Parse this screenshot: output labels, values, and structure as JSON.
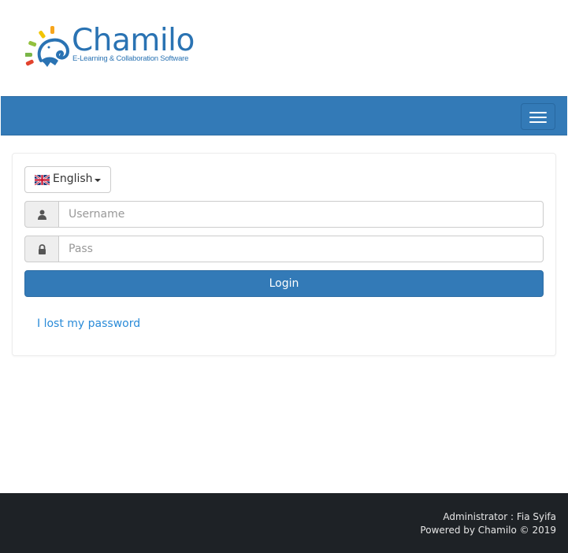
{
  "header": {
    "logo_name": "Chamilo",
    "logo_tagline": "E-Learning & Collaboration Software"
  },
  "navbar": {
    "color": "#337ab7",
    "toggle_icon": "hamburger-menu-icon"
  },
  "login_form": {
    "language": {
      "selected": "English",
      "flag_icon": "uk-flag-icon"
    },
    "username": {
      "placeholder": "Username",
      "value": "",
      "icon": "user-icon"
    },
    "password": {
      "placeholder": "Pass",
      "value": "",
      "icon": "lock-icon"
    },
    "submit_label": "Login",
    "lost_password_label": "I lost my password"
  },
  "footer": {
    "admin_line": "Administrator : Fia Syifa",
    "powered_line": "Powered by Chamilo © 2019"
  },
  "colors": {
    "primary": "#337ab7",
    "link": "#2a8bd8",
    "footer_bg": "#1e2226"
  }
}
